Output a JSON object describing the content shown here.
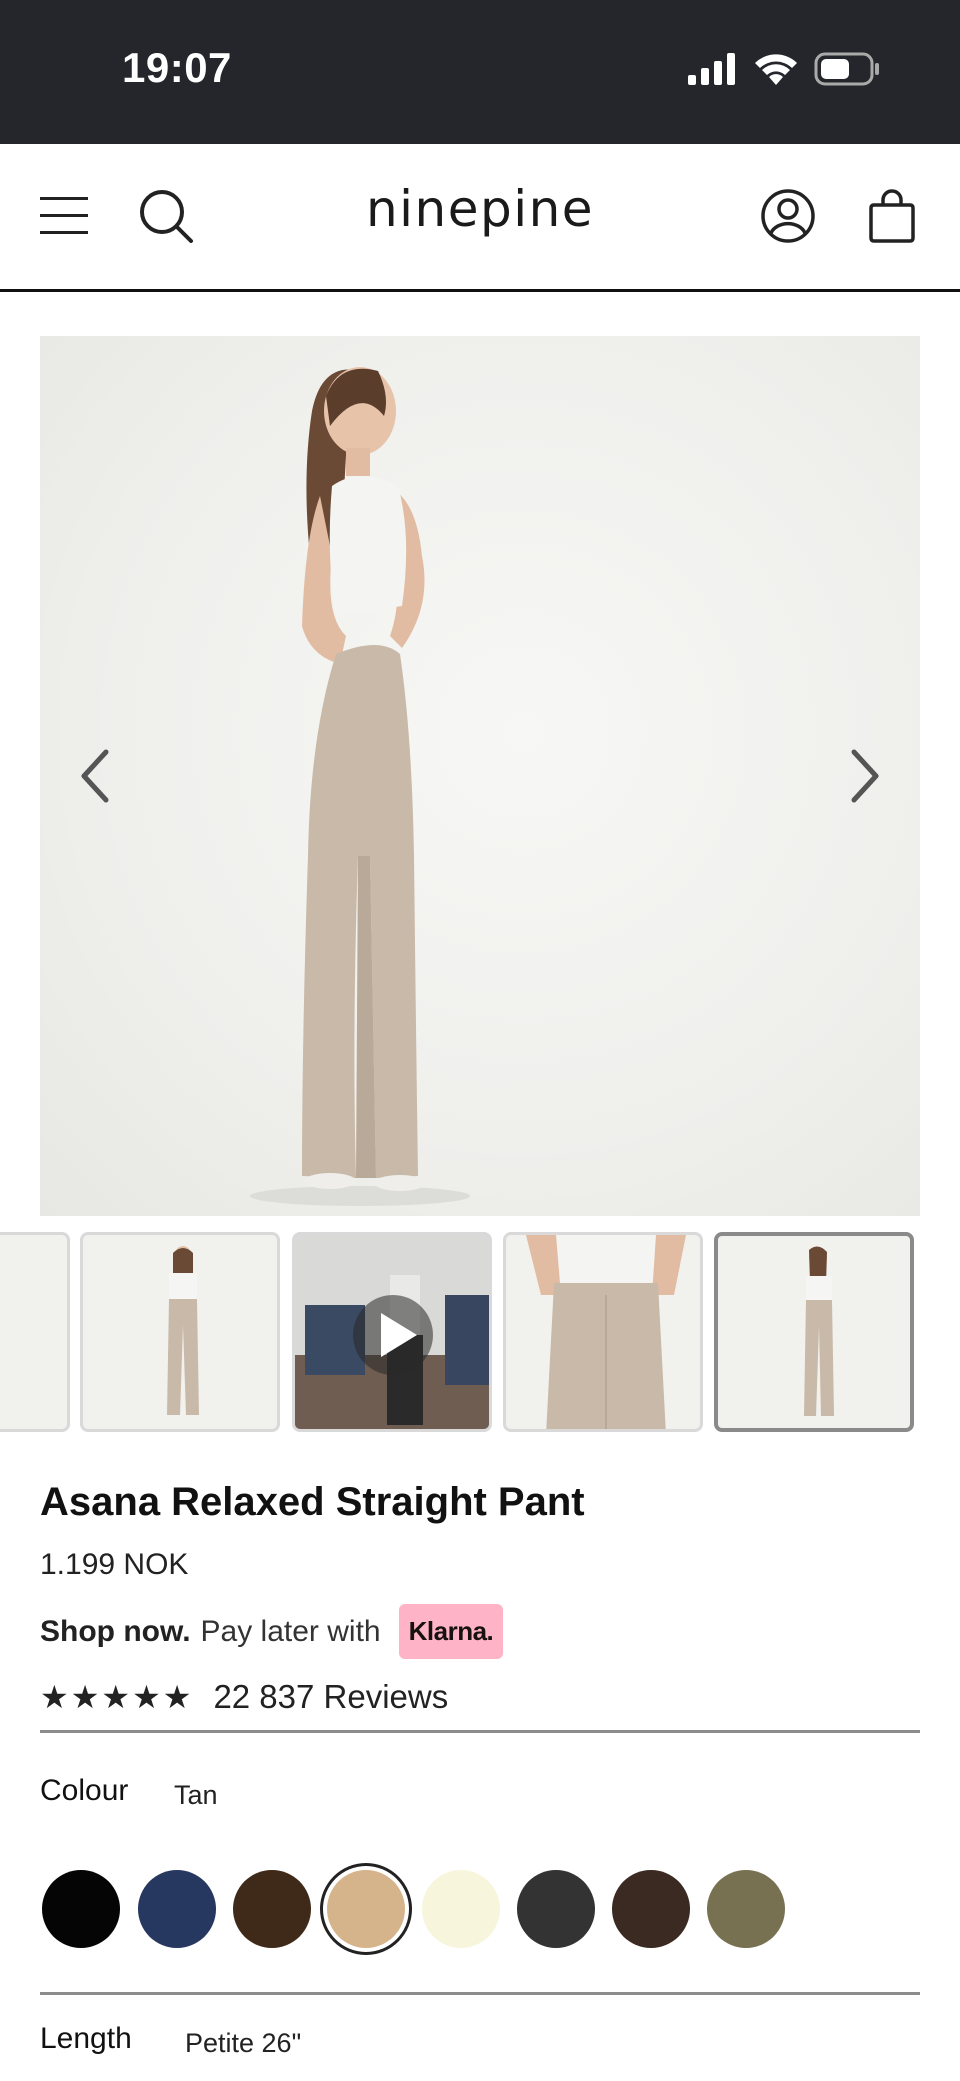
{
  "status_bar": {
    "time": "19:07"
  },
  "header": {
    "brand": "ninepine"
  },
  "product": {
    "title": "Asana Relaxed Straight Pant",
    "price": "1.199 NOK",
    "klarna": {
      "shop_now": "Shop now.",
      "pay_later": "Pay later with",
      "badge": "Klarna."
    },
    "rating": {
      "stars": "★★★★★",
      "reviews": "22 837 Reviews"
    },
    "colour": {
      "label": "Colour",
      "selected": "Tan",
      "swatches": [
        {
          "name": "black",
          "hex": "#050505"
        },
        {
          "name": "navy",
          "hex": "#263760"
        },
        {
          "name": "chocolate",
          "hex": "#3f2a1a"
        },
        {
          "name": "tan",
          "hex": "#d6b48b"
        },
        {
          "name": "cream",
          "hex": "#f7f5dc"
        },
        {
          "name": "charcoal",
          "hex": "#333333"
        },
        {
          "name": "espresso",
          "hex": "#3a2a22"
        },
        {
          "name": "olive",
          "hex": "#777152"
        }
      ]
    },
    "length": {
      "label": "Length",
      "selected": "Petite 26\""
    }
  },
  "colors": {
    "statusbar": "#24262b",
    "klarna": "#ffb3c7",
    "pant": "#c9b9a8"
  }
}
